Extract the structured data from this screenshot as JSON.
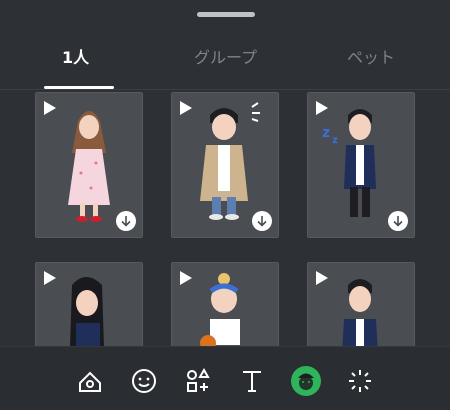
{
  "tabs": [
    {
      "label": "1人",
      "active": true
    },
    {
      "label": "グループ",
      "active": false
    },
    {
      "label": "ペット",
      "active": false
    }
  ],
  "cards": [
    {
      "name": "woman-pink-dress",
      "play_icon": "play-icon",
      "download_icon": "download-icon"
    },
    {
      "name": "man-trench-coat",
      "play_icon": "play-icon",
      "download_icon": "download-icon"
    },
    {
      "name": "sleeping-student",
      "play_icon": "play-icon",
      "download_icon": "download-icon"
    },
    {
      "name": "girl-long-hair",
      "play_icon": "play-icon"
    },
    {
      "name": "basketball-kid",
      "play_icon": "play-icon"
    },
    {
      "name": "boy-school-uniform",
      "play_icon": "play-icon"
    }
  ],
  "toolbar": {
    "items": [
      "image-shapes-icon",
      "smiley-icon",
      "shapes-plus-icon",
      "text-icon",
      "avatar-icon",
      "sparkle-icon"
    ],
    "active_item": "avatar-icon",
    "accent_color": "#2fb35b"
  }
}
